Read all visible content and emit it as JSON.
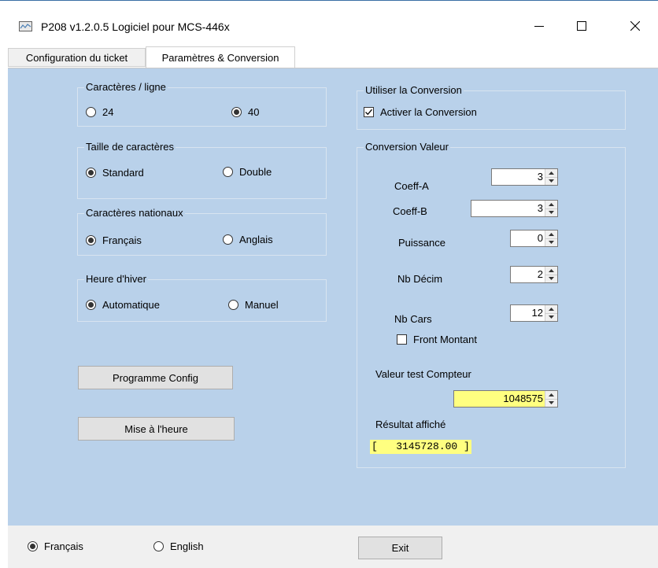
{
  "window": {
    "title": "P208 v1.2.0.5 Logiciel pour MCS-446x"
  },
  "tabs": [
    {
      "label": "Configuration du ticket",
      "active": false
    },
    {
      "label": "Paramètres & Conversion",
      "active": true
    }
  ],
  "chars_per_line": {
    "label": "Caractères / ligne",
    "options": [
      {
        "label": "24",
        "selected": false
      },
      {
        "label": "40",
        "selected": true
      }
    ]
  },
  "char_size": {
    "label": "Taille de caractères",
    "options": [
      {
        "label": "Standard",
        "selected": true
      },
      {
        "label": "Double",
        "selected": false
      }
    ]
  },
  "national_chars": {
    "label": "Caractères nationaux",
    "options": [
      {
        "label": "Français",
        "selected": true
      },
      {
        "label": "Anglais",
        "selected": false
      }
    ]
  },
  "winter_time": {
    "label": "Heure d'hiver",
    "options": [
      {
        "label": "Automatique",
        "selected": true
      },
      {
        "label": "Manuel",
        "selected": false
      }
    ]
  },
  "buttons": {
    "program_config": "Programme Config",
    "set_time": "Mise à l'heure",
    "exit": "Exit"
  },
  "use_conversion": {
    "label": "Utiliser la Conversion",
    "activate_label": "Activer la Conversion",
    "activate_checked": true
  },
  "conversion_value": {
    "label": "Conversion Valeur",
    "coeff_a": {
      "label": "Coeff-A",
      "value": "3"
    },
    "coeff_b": {
      "label": "Coeff-B",
      "value": "3"
    },
    "power": {
      "label": "Puissance",
      "value": "0"
    },
    "nb_decim": {
      "label": "Nb Décim",
      "value": "2"
    },
    "nb_cars": {
      "label": "Nb Cars",
      "value": "12"
    },
    "rising_edge": {
      "label": "Front Montant",
      "checked": false
    },
    "test_counter_label": "Valeur test Compteur",
    "test_counter_value": "1048575",
    "result_label": "Résultat affiché",
    "result_value": "[   3145728.00 ]"
  },
  "language": {
    "options": [
      {
        "label": "Français",
        "selected": true
      },
      {
        "label": "English",
        "selected": false
      }
    ]
  },
  "colors": {
    "panel_bg": "#b9d1ea",
    "highlight_yellow": "#ffff80",
    "window_bg": "#f0f0f0"
  }
}
